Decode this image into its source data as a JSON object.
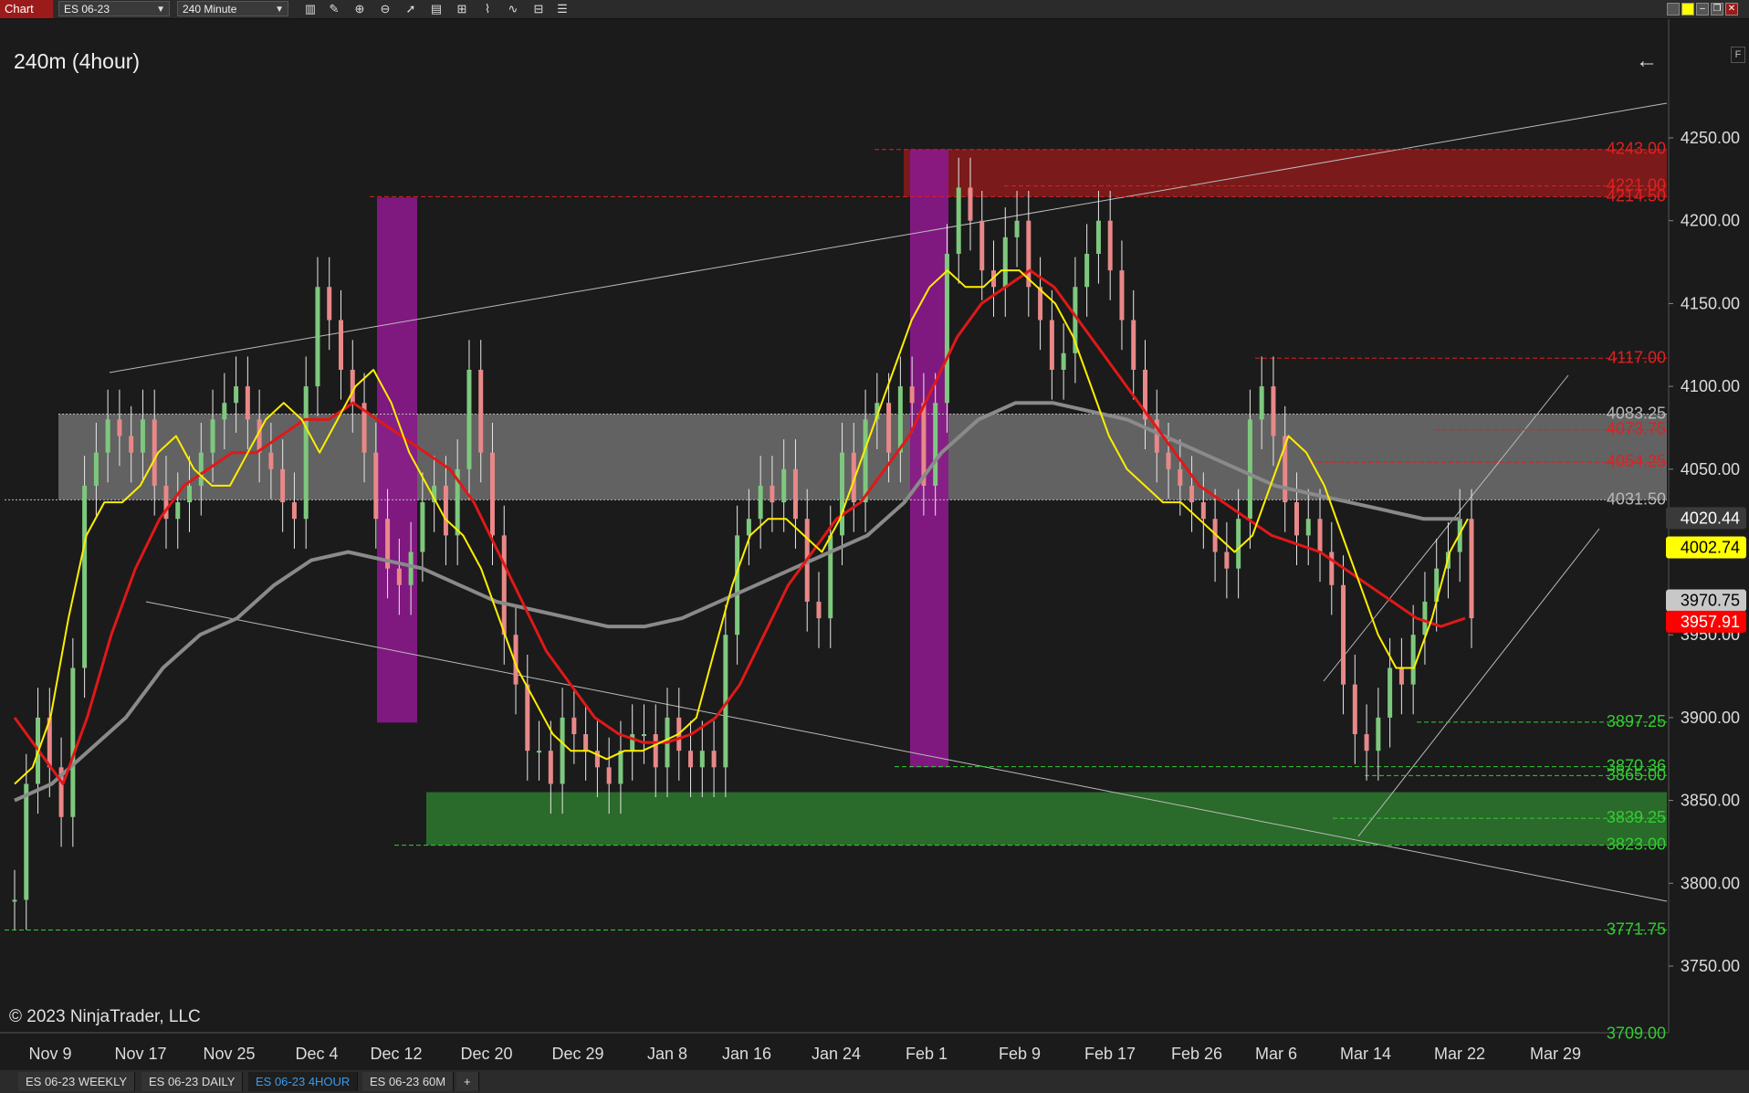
{
  "toolbar": {
    "chart_tab": "Chart",
    "instrument": "ES 06-23",
    "interval": "240 Minute",
    "icons": [
      "bar-type-icon",
      "draw-pencil-icon",
      "zoom-in-icon",
      "zoom-out-icon",
      "pointer-icon",
      "properties-icon",
      "template-icon",
      "indicators-icon",
      "strategies-icon",
      "chart-trader-icon"
    ]
  },
  "chart_data": {
    "type": "line",
    "title": "240m (4hour)",
    "copyright": "© 2023 NinjaTrader, LLC",
    "ylim": [
      3700,
      4285
    ],
    "y_ticks": [
      "4250.00",
      "4200.00",
      "4150.00",
      "4100.00",
      "4050.00",
      "4000.00",
      "3950.00",
      "3900.00",
      "3850.00",
      "3800.00",
      "3750.00"
    ],
    "x_ticks": [
      "Nov 9",
      "Nov 17",
      "Nov 25",
      "Dec 4",
      "Dec 12",
      "Dec 20",
      "Dec 29",
      "Jan 8",
      "Jan 16",
      "Jan 24",
      "Feb 1",
      "Feb 9",
      "Feb 17",
      "Feb 26",
      "Mar 6",
      "Mar 14",
      "Mar 22",
      "Mar 29"
    ],
    "resistance_levels": [
      {
        "label": "4243.00",
        "value": 4243.0
      },
      {
        "label": "4221.00",
        "value": 4221.0
      },
      {
        "label": "4214.50",
        "value": 4214.5
      },
      {
        "label": "4117.00",
        "value": 4117.0
      },
      {
        "label": "4073.75",
        "value": 4073.75
      },
      {
        "label": "4054.25",
        "value": 4054.25
      }
    ],
    "gray_levels": [
      {
        "label": "4083.25",
        "value": 4083.25
      },
      {
        "label": "4031.50",
        "value": 4031.5
      }
    ],
    "support_levels": [
      {
        "label": "3897.25",
        "value": 3897.25
      },
      {
        "label": "3870.36",
        "value": 3870.36
      },
      {
        "label": "3865.00",
        "value": 3865.0
      },
      {
        "label": "3839.25",
        "value": 3839.25
      },
      {
        "label": "3823.00",
        "value": 3823.0
      },
      {
        "label": "3771.75",
        "value": 3771.75
      },
      {
        "label": "3709.00",
        "value": 3709.0
      }
    ],
    "price_markers": [
      {
        "label": "4020.44",
        "value": 4020.44,
        "bg": "#3a3a3a",
        "fg": "#ffffff"
      },
      {
        "label": "4002.74",
        "value": 4002.74,
        "bg": "#ffff00",
        "fg": "#000000"
      },
      {
        "label": "3970.75",
        "value": 3970.75,
        "bg": "#c8c8c8",
        "fg": "#000000"
      },
      {
        "label": "3957.91",
        "value": 3957.91,
        "bg": "#ff0000",
        "fg": "#ffffff"
      }
    ],
    "zones": {
      "red": [
        4214.5,
        4243.0
      ],
      "gray": [
        4031.5,
        4083.25
      ],
      "green": [
        3823.0,
        3855.0
      ]
    },
    "price_series": [
      3790,
      3860,
      3900,
      3870,
      3840,
      3930,
      4040,
      4060,
      4080,
      4070,
      4060,
      4080,
      4040,
      4020,
      4030,
      4040,
      4060,
      4080,
      4090,
      4100,
      4080,
      4060,
      4050,
      4030,
      4020,
      4100,
      4160,
      4140,
      4110,
      4090,
      4060,
      4020,
      3990,
      3980,
      4000,
      4030,
      4040,
      4010,
      4050,
      4110,
      4060,
      4010,
      3950,
      3920,
      3880,
      3880,
      3860,
      3900,
      3890,
      3880,
      3870,
      3860,
      3880,
      3890,
      3890,
      3870,
      3900,
      3880,
      3870,
      3880,
      3870,
      3950,
      4010,
      4020,
      4040,
      4030,
      4050,
      4020,
      3970,
      3960,
      4010,
      4060,
      4030,
      4080,
      4090,
      4060,
      4100,
      4090,
      4040,
      4090,
      4180,
      4220,
      4200,
      4170,
      4160,
      4190,
      4200,
      4160,
      4140,
      4110,
      4120,
      4160,
      4180,
      4200,
      4170,
      4140,
      4110,
      4080,
      4060,
      4050,
      4040,
      4030,
      4020,
      4000,
      3990,
      4020,
      4080,
      4100,
      4070,
      4030,
      4010,
      4020,
      4000,
      3980,
      3920,
      3890,
      3880,
      3900,
      3930,
      3920,
      3950,
      3970,
      3990,
      4000,
      4020,
      3960
    ],
    "ema_fast": [
      3860,
      3870,
      3900,
      3960,
      4010,
      4030,
      4030,
      4040,
      4060,
      4070,
      4050,
      4040,
      4040,
      4060,
      4080,
      4090,
      4080,
      4060,
      4080,
      4100,
      4110,
      4090,
      4060,
      4040,
      4020,
      4010,
      3990,
      3960,
      3930,
      3910,
      3890,
      3880,
      3880,
      3875,
      3880,
      3880,
      3885,
      3890,
      3900,
      3940,
      3980,
      4010,
      4020,
      4020,
      4010,
      4000,
      4020,
      4050,
      4080,
      4110,
      4140,
      4160,
      4170,
      4160,
      4160,
      4170,
      4170,
      4160,
      4150,
      4130,
      4100,
      4070,
      4050,
      4040,
      4030,
      4030,
      4020,
      4010,
      4000,
      4010,
      4040,
      4070,
      4060,
      4040,
      4010,
      3980,
      3950,
      3930,
      3930,
      3960,
      4000,
      4020
    ],
    "ema_mid": [
      3900,
      3880,
      3860,
      3900,
      3950,
      3990,
      4020,
      4040,
      4050,
      4060,
      4060,
      4070,
      4080,
      4080,
      4090,
      4080,
      4070,
      4060,
      4050,
      4030,
      4000,
      3970,
      3940,
      3920,
      3900,
      3890,
      3885,
      3885,
      3890,
      3900,
      3920,
      3950,
      3980,
      4000,
      4020,
      4030,
      4050,
      4070,
      4100,
      4130,
      4150,
      4160,
      4170,
      4160,
      4140,
      4120,
      4100,
      4080,
      4060,
      4040,
      4030,
      4020,
      4010,
      4005,
      4000,
      3990,
      3980,
      3970,
      3960,
      3955,
      3960
    ],
    "ema_slow": [
      3850,
      3860,
      3880,
      3900,
      3930,
      3950,
      3960,
      3980,
      3995,
      4000,
      3995,
      3990,
      3980,
      3970,
      3965,
      3960,
      3955,
      3955,
      3960,
      3970,
      3980,
      3990,
      4000,
      4010,
      4030,
      4060,
      4080,
      4090,
      4090,
      4085,
      4080,
      4070,
      4060,
      4050,
      4040,
      4035,
      4030,
      4025,
      4020,
      4020
    ]
  },
  "bottom_tabs": [
    {
      "label": "ES 06-23 WEEKLY",
      "active": false
    },
    {
      "label": "ES 06-23 DAILY",
      "active": false
    },
    {
      "label": "ES 06-23 4HOUR",
      "active": true
    },
    {
      "label": "ES 06-23 60M",
      "active": false
    }
  ],
  "add_tab": "+",
  "back_icon": "arrow-left-icon",
  "f_label": "F"
}
